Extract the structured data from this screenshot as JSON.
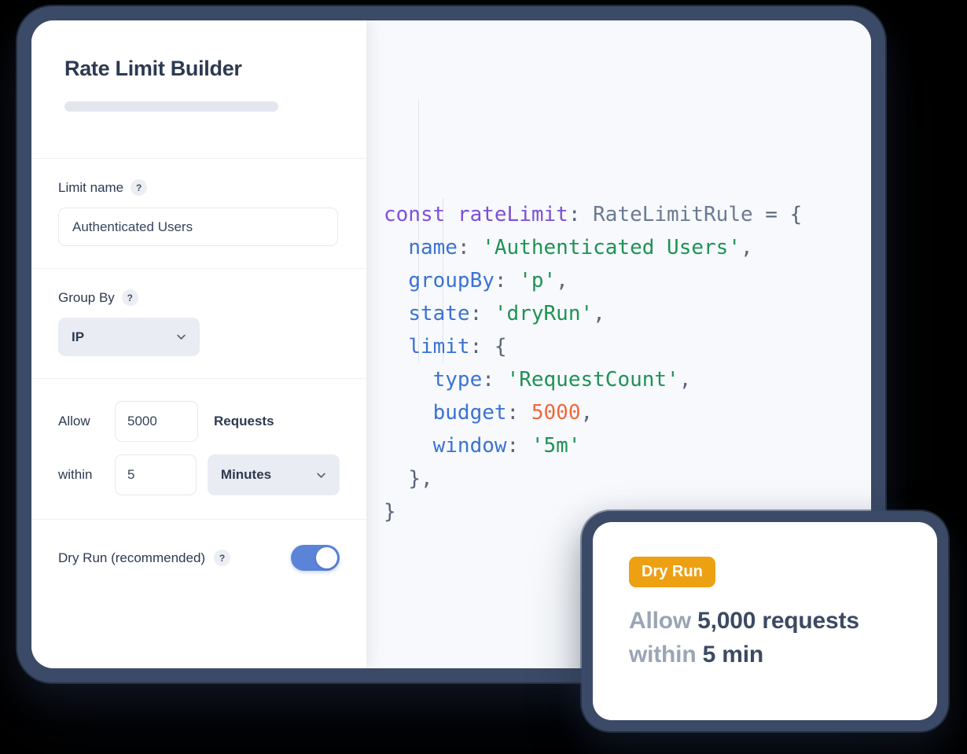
{
  "window": {
    "title": "Rate Limit Builder"
  },
  "form": {
    "limit_name": {
      "label": "Limit name",
      "help": "?",
      "value": "Authenticated Users"
    },
    "group_by": {
      "label": "Group By",
      "help": "?",
      "value": "IP",
      "chevron": "chevron-down-icon"
    },
    "rate": {
      "allow_label": "Allow",
      "count_value": "5000",
      "count_unit": "Requests",
      "within_label": "within",
      "window_value": "5",
      "window_unit": "Minutes",
      "chevron": "chevron-down-icon"
    },
    "dry_run": {
      "label": "Dry Run (recommended)",
      "help": "?",
      "enabled": true
    }
  },
  "code": {
    "lines": [
      {
        "indent": 0,
        "tokens": [
          {
            "t": "const",
            "c": "kw"
          },
          {
            "t": " ",
            "c": "punct"
          },
          {
            "t": "rateLimit",
            "c": "var"
          },
          {
            "t": ": ",
            "c": "punct"
          },
          {
            "t": "RateLimitRule",
            "c": "type"
          },
          {
            "t": " = {",
            "c": "punct"
          }
        ]
      },
      {
        "indent": 1,
        "tokens": [
          {
            "t": "name",
            "c": "key"
          },
          {
            "t": ": ",
            "c": "punct"
          },
          {
            "t": "'Authenticated Users'",
            "c": "str"
          },
          {
            "t": ",",
            "c": "punct"
          }
        ]
      },
      {
        "indent": 1,
        "tokens": [
          {
            "t": "groupBy",
            "c": "key"
          },
          {
            "t": ": ",
            "c": "punct"
          },
          {
            "t": "'p'",
            "c": "str"
          },
          {
            "t": ",",
            "c": "punct"
          }
        ]
      },
      {
        "indent": 1,
        "tokens": [
          {
            "t": "state",
            "c": "key"
          },
          {
            "t": ": ",
            "c": "punct"
          },
          {
            "t": "'dryRun'",
            "c": "str"
          },
          {
            "t": ",",
            "c": "punct"
          }
        ]
      },
      {
        "indent": 1,
        "tokens": [
          {
            "t": "limit",
            "c": "key"
          },
          {
            "t": ": {",
            "c": "punct"
          }
        ]
      },
      {
        "indent": 2,
        "tokens": [
          {
            "t": "type",
            "c": "key"
          },
          {
            "t": ": ",
            "c": "punct"
          },
          {
            "t": "'RequestCount'",
            "c": "str"
          },
          {
            "t": ",",
            "c": "punct"
          }
        ]
      },
      {
        "indent": 2,
        "tokens": [
          {
            "t": "budget",
            "c": "key"
          },
          {
            "t": ": ",
            "c": "punct"
          },
          {
            "t": "5000",
            "c": "num"
          },
          {
            "t": ",",
            "c": "punct"
          }
        ]
      },
      {
        "indent": 2,
        "tokens": [
          {
            "t": "window",
            "c": "key"
          },
          {
            "t": ": ",
            "c": "punct"
          },
          {
            "t": "'5m'",
            "c": "str"
          }
        ]
      },
      {
        "indent": 1,
        "tokens": [
          {
            "t": "},",
            "c": "punct"
          }
        ]
      },
      {
        "indent": 0,
        "tokens": [
          {
            "t": "}",
            "c": "punct"
          }
        ]
      }
    ]
  },
  "summary_card": {
    "badge": "Dry Run",
    "line1_prefix": "Allow ",
    "line1_strong": "5,000 requests",
    "line2_prefix": "within ",
    "line2_strong": "5 min"
  },
  "colors": {
    "frame": "#3b4a66",
    "panel_bg": "#ffffff",
    "code_bg": "#f7f9fc",
    "toggle_on": "#5b84d8",
    "badge_amber": "#eda012",
    "text_dark": "#2d3a50",
    "text_muted": "#9aa5b5",
    "syntax_keyword": "#8250df",
    "syntax_variable": "#7b4fd8",
    "syntax_type": "#6b7a90",
    "syntax_key": "#3b72d4",
    "syntax_string": "#1f9254",
    "syntax_number": "#f1683a"
  }
}
